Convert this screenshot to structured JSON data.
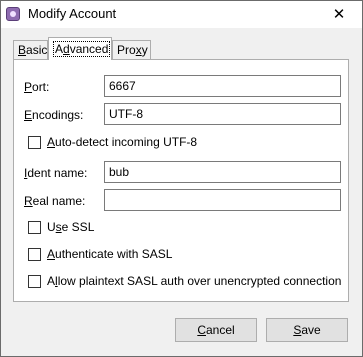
{
  "window": {
    "title": "Modify Account",
    "close_glyph": "✕"
  },
  "tabs": [
    {
      "prefix": "",
      "mnemonic": "B",
      "rest": "asic"
    },
    {
      "prefix": "A",
      "mnemonic": "d",
      "rest": "vanced"
    },
    {
      "prefix": "Pro",
      "mnemonic": "x",
      "rest": "y"
    }
  ],
  "fields": {
    "port": {
      "mnemonic": "P",
      "rest": "ort:",
      "value": "6667"
    },
    "encodings": {
      "mnemonic": "E",
      "rest": "ncodings:",
      "value": "UTF-8"
    },
    "ident": {
      "mnemonic": "I",
      "rest": "dent name:",
      "value": "bub"
    },
    "realname": {
      "mnemonic": "R",
      "rest": "eal name:",
      "value": ""
    }
  },
  "checkboxes": {
    "autodetect": {
      "mnemonic": "A",
      "rest": "uto-detect incoming UTF-8",
      "checked": false
    },
    "use_ssl": {
      "prefix": "U",
      "mnemonic": "s",
      "rest": "e SSL",
      "checked": false
    },
    "sasl": {
      "mnemonic": "A",
      "rest": "uthenticate with SASL",
      "checked": false
    },
    "plaintext": {
      "prefix": "A",
      "mnemonic": "l",
      "rest": "low plaintext SASL auth over unencrypted connection",
      "checked": false
    }
  },
  "buttons": {
    "cancel": {
      "mnemonic": "C",
      "rest": "ancel"
    },
    "save": {
      "mnemonic": "S",
      "rest": "ave"
    }
  }
}
